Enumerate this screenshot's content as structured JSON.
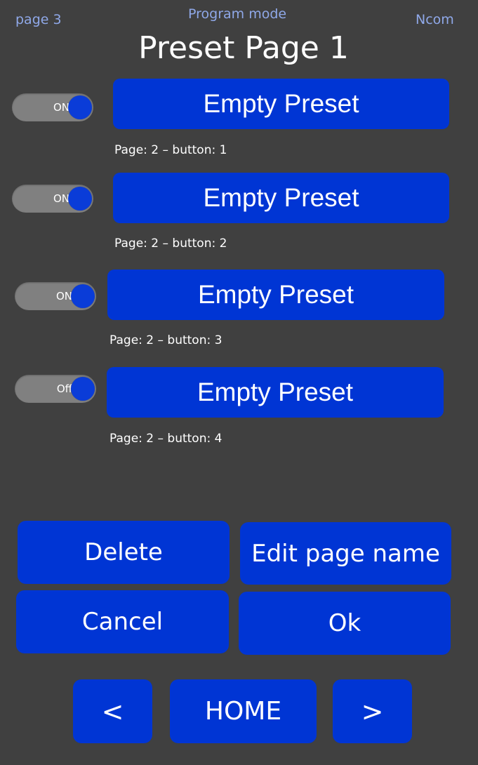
{
  "header": {
    "left": "page 3",
    "center": "Program mode",
    "right": "Ncom"
  },
  "title": "Preset Page 1",
  "presets": [
    {
      "toggle": "ON",
      "label": "Empty Preset",
      "caption": "Page: 2 – button: 1"
    },
    {
      "toggle": "ON",
      "label": "Empty Preset",
      "caption": "Page: 2 – button: 2"
    },
    {
      "toggle": "ON",
      "label": "Empty Preset",
      "caption": "Page: 2 – button: 3"
    },
    {
      "toggle": "Off",
      "label": "Empty Preset",
      "caption": "Page: 2 – button: 4"
    }
  ],
  "actions": {
    "delete": "Delete",
    "edit_page_name": "Edit page name",
    "cancel": "Cancel",
    "ok": "Ok"
  },
  "nav": {
    "prev": "<",
    "home": "HOME",
    "next": ">"
  },
  "colors": {
    "background": "#404040",
    "button": "#0035d4",
    "header_text": "#8fa8e8",
    "toggle_track": "#808080"
  }
}
